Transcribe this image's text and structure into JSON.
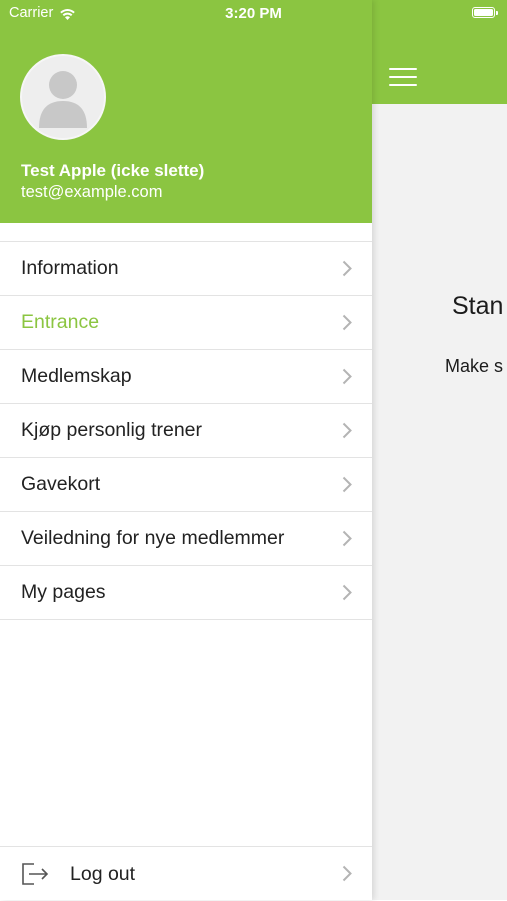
{
  "status_bar": {
    "carrier": "Carrier",
    "time": "3:20 PM"
  },
  "drawer": {
    "user": {
      "name": "Test Apple (icke slette)",
      "email": "test@example.com"
    },
    "menu_items": [
      {
        "label": "Information",
        "active": false
      },
      {
        "label": "Entrance",
        "active": true
      },
      {
        "label": "Medlemskap",
        "active": false
      },
      {
        "label": "Kjøp personlig trener",
        "active": false
      },
      {
        "label": "Gavekort",
        "active": false
      },
      {
        "label": "Veiledning for nye medlemmer",
        "active": false
      },
      {
        "label": "My pages",
        "active": false
      }
    ],
    "logout_label": "Log out"
  },
  "main": {
    "title_partial": "Stan",
    "text_partial": "Make s"
  },
  "colors": {
    "accent": "#8bc541",
    "text": "#222222",
    "divider": "#e3e3e3",
    "background": "#f2f2f2"
  },
  "icons": [
    "wifi-icon",
    "battery-icon",
    "avatar-placeholder-icon",
    "hamburger-menu-icon",
    "chevron-right-icon",
    "logout-icon"
  ]
}
